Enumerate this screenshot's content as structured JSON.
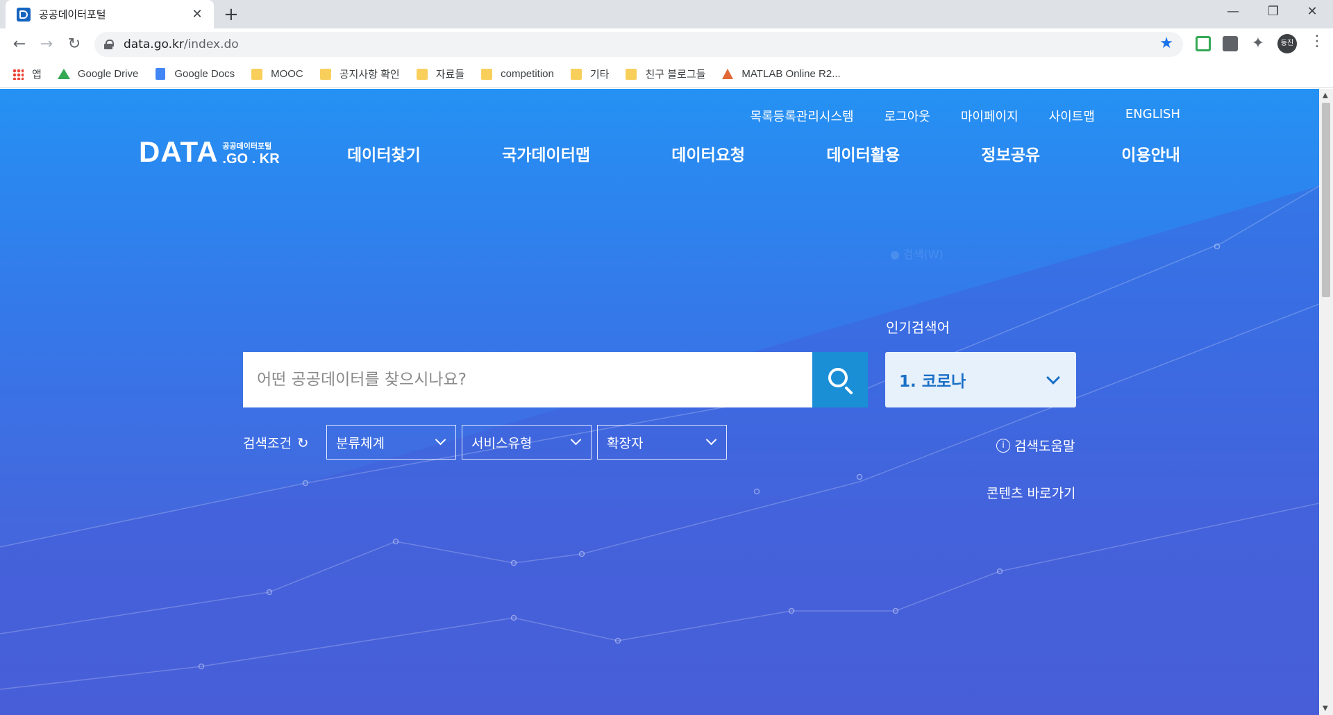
{
  "browser": {
    "tab_title": "공공데이터포털",
    "tab_close": "✕",
    "new_tab": "+",
    "window_controls": [
      "—",
      "❐",
      "✕"
    ],
    "url_host": "data.go.kr",
    "url_path": "/index.do",
    "profile_label": "동진",
    "bookmarks": [
      {
        "label": "앱",
        "icon": "apps-icon"
      },
      {
        "label": "Google Drive",
        "icon": "google-drive-icon"
      },
      {
        "label": "Google Docs",
        "icon": "google-docs-icon"
      },
      {
        "label": "MOOC",
        "icon": "folder-icon"
      },
      {
        "label": "공지사항 확인",
        "icon": "folder-icon"
      },
      {
        "label": "자료들",
        "icon": "folder-icon"
      },
      {
        "label": "competition",
        "icon": "folder-icon"
      },
      {
        "label": "기타",
        "icon": "folder-icon"
      },
      {
        "label": "친구 블로그들",
        "icon": "folder-icon"
      },
      {
        "label": "MATLAB Online R2...",
        "icon": "matlab-icon"
      }
    ]
  },
  "site": {
    "logo_main": "DATA",
    "logo_small": "공공데이터포털",
    "logo_suffix": ".GO . KR",
    "util_nav": [
      "목록등록관리시스템",
      "로그아웃",
      "마이페이지",
      "사이트맵",
      "ENGLISH"
    ],
    "main_nav": [
      "데이터찾기",
      "국가데이터맵",
      "데이터요청",
      "데이터활용",
      "정보공유",
      "이용안내"
    ],
    "faint_text": "● 검색(W)",
    "search": {
      "placeholder": "어떤 공공데이터를 찾으시나요?",
      "value": ""
    },
    "popular_label": "인기검색어",
    "popular_selected": "1. 코로나",
    "condition_label": "검색조건",
    "reset_icon": "↻",
    "filters": [
      "분류체계",
      "서비스유형",
      "확장자"
    ],
    "help_info": "i",
    "help_label": "검색도움말",
    "shortcut_label": "콘텐츠 바로가기"
  },
  "colors": {
    "accent": "#1a8fd6",
    "popular_text": "#1a6fc7",
    "bg_top": "#2591f3",
    "bg_bottom": "#4a62da"
  }
}
